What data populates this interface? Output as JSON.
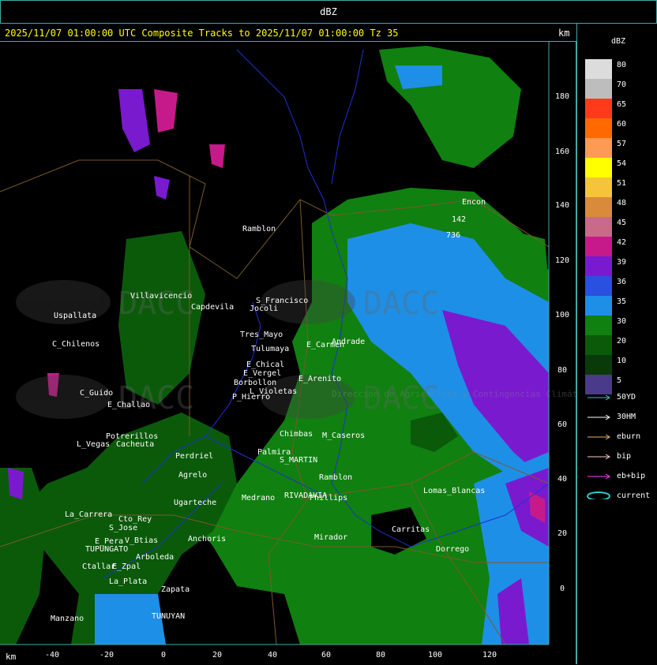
{
  "header": {
    "field": "dBZ"
  },
  "title_line": "2025/11/07 01:00:00 UTC Composite Tracks to 2025/11/07 01:00:00 Tz 35",
  "km_top": "km",
  "km_bottom": "km",
  "axis": {
    "x_ticks": [
      "-40",
      "-20",
      "0",
      "20",
      "40",
      "60",
      "80",
      "100",
      "120"
    ],
    "y_ticks": [
      "180",
      "160",
      "140",
      "120",
      "100",
      "80",
      "60",
      "40",
      "20",
      "0"
    ]
  },
  "legend": {
    "title": "dBZ",
    "levels": [
      {
        "label": "80",
        "color": "#dcdcdc"
      },
      {
        "label": "70",
        "color": "#bdbdbd"
      },
      {
        "label": "65",
        "color": "#ff3a1a"
      },
      {
        "label": "60",
        "color": "#ff6a00"
      },
      {
        "label": "57",
        "color": "#ff9a55"
      },
      {
        "label": "54",
        "color": "#ffff00"
      },
      {
        "label": "51",
        "color": "#f5c43a"
      },
      {
        "label": "48",
        "color": "#d98a3a"
      },
      {
        "label": "45",
        "color": "#c96a88"
      },
      {
        "label": "42",
        "color": "#c71a8a"
      },
      {
        "label": "39",
        "color": "#7a1acf"
      },
      {
        "label": "36",
        "color": "#2a50e0"
      },
      {
        "label": "35",
        "color": "#1e8fe6"
      },
      {
        "label": "30",
        "color": "#108010"
      },
      {
        "label": "20",
        "color": "#0a5a0a"
      },
      {
        "label": "10",
        "color": "#0a3a0a"
      },
      {
        "label": "5",
        "color": "#4a3a8a"
      }
    ],
    "tracks": [
      {
        "label": "50YD",
        "color": "#30c8c8"
      },
      {
        "label": "30HM",
        "color": "#ffffff"
      },
      {
        "label": "eburn",
        "color": "#e8b070"
      },
      {
        "label": "bip",
        "color": "#ffc8c8"
      },
      {
        "label": "eb+bip",
        "color": "#ff40ff"
      },
      {
        "label": "current",
        "color": "#30c8c8"
      }
    ]
  },
  "watermark": {
    "text": "DACC",
    "subtitle": "Dirección de Agricultura y Contingencias Climáticas"
  },
  "places": [
    {
      "name": "Encon"
    },
    {
      "name": "Ramblon"
    },
    {
      "name": "S_Francisco"
    },
    {
      "name": "Jocoli"
    },
    {
      "name": "Tres_Mayo"
    },
    {
      "name": "Tulumaya"
    },
    {
      "name": "E_Carmen"
    },
    {
      "name": "E_Chical"
    },
    {
      "name": "E_Vergel"
    },
    {
      "name": "Borbollon"
    },
    {
      "name": "L_Violetas"
    },
    {
      "name": "P_Hierro"
    },
    {
      "name": "E_Arenito"
    },
    {
      "name": "Villavicencio"
    },
    {
      "name": "Uspallata"
    },
    {
      "name": "C_Chilenos"
    },
    {
      "name": "C_Guido"
    },
    {
      "name": "E_Challao"
    },
    {
      "name": "Potrerillos"
    },
    {
      "name": "L_Vegas"
    },
    {
      "name": "Cacheuta"
    },
    {
      "name": "Perdriel"
    },
    {
      "name": "Agrelo"
    },
    {
      "name": "Ugarteche"
    },
    {
      "name": "La_Carrera"
    },
    {
      "name": "Cto_Rey"
    },
    {
      "name": "S_Jose"
    },
    {
      "name": "E_Pera"
    },
    {
      "name": "TUPUNGATO"
    },
    {
      "name": "V_Btias"
    },
    {
      "name": "Anchoris"
    },
    {
      "name": "Arboleda"
    },
    {
      "name": "Ctallar"
    },
    {
      "name": "E_Zpal"
    },
    {
      "name": "La_Plata"
    },
    {
      "name": "Zapata"
    },
    {
      "name": "Manzano"
    },
    {
      "name": "TUNUYAN"
    },
    {
      "name": "Medrano"
    },
    {
      "name": "RIVADAVIA"
    },
    {
      "name": "Phillips"
    },
    {
      "name": "Lomas_Blancas"
    },
    {
      "name": "Carritas"
    },
    {
      "name": "Dorrego"
    },
    {
      "name": "Mirador"
    },
    {
      "name": "S_MARTIN"
    },
    {
      "name": "Capdevila"
    },
    {
      "name": "Palmira"
    },
    {
      "name": "M_Caseros"
    },
    {
      "name": "Chimbas"
    },
    {
      "name": "Andrade"
    },
    {
      "name": "Ramblon"
    },
    {
      "name": "736"
    },
    {
      "name": "142"
    }
  ]
}
